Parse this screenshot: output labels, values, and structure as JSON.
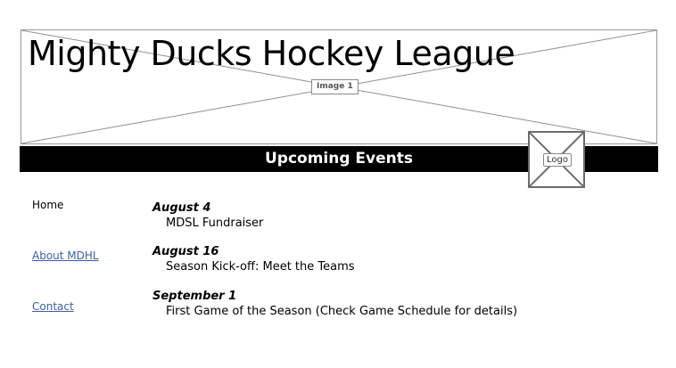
{
  "header": {
    "title": "Mighty Ducks Hockey League",
    "image_label": "Image 1"
  },
  "bar": {
    "title": "Upcoming Events"
  },
  "logo": {
    "label": "Logo"
  },
  "nav": {
    "home": "Home",
    "about": "About MDHL",
    "contact": "Contact"
  },
  "events": [
    {
      "date": "August 4",
      "description": "MDSL Fundraiser"
    },
    {
      "date": "August 16",
      "description": "Season Kick-off: Meet the Teams"
    },
    {
      "date": "September 1",
      "description": "First Game of the Season (Check Game Schedule for details)"
    }
  ],
  "colors": {
    "bar_background": "#000000",
    "link": "#3a5fa8"
  }
}
